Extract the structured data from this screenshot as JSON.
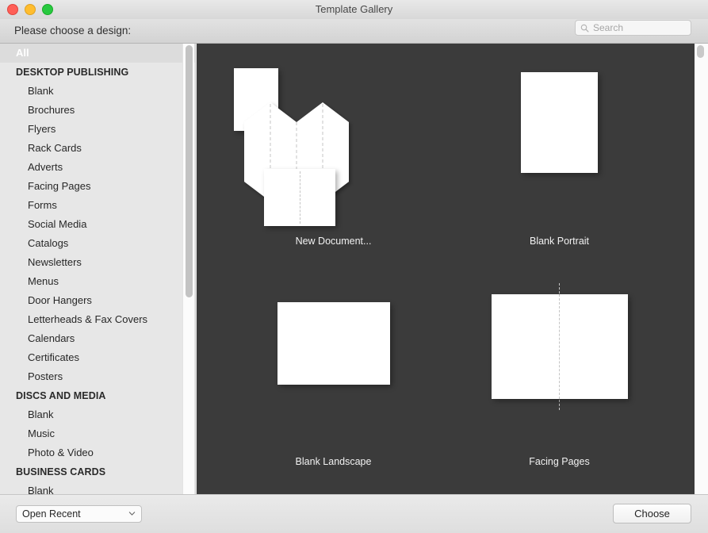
{
  "window": {
    "title": "Template Gallery",
    "traffic_lights": [
      "close-button",
      "minimize-button",
      "zoom-button"
    ]
  },
  "toolbar": {
    "prompt": "Please choose a design:",
    "search": {
      "placeholder": "Search",
      "value": "",
      "icon": "search-icon"
    }
  },
  "sidebar": {
    "selected": "All",
    "items": [
      {
        "label": "All",
        "type": "selected"
      },
      {
        "label": "DESKTOP PUBLISHING",
        "type": "group"
      },
      {
        "label": "Blank",
        "type": "item"
      },
      {
        "label": "Brochures",
        "type": "item"
      },
      {
        "label": "Flyers",
        "type": "item"
      },
      {
        "label": "Rack Cards",
        "type": "item"
      },
      {
        "label": "Adverts",
        "type": "item"
      },
      {
        "label": "Facing Pages",
        "type": "item"
      },
      {
        "label": "Forms",
        "type": "item"
      },
      {
        "label": "Social Media",
        "type": "item"
      },
      {
        "label": "Catalogs",
        "type": "item"
      },
      {
        "label": "Newsletters",
        "type": "item"
      },
      {
        "label": "Menus",
        "type": "item"
      },
      {
        "label": "Door Hangers",
        "type": "item"
      },
      {
        "label": "Letterheads & Fax Covers",
        "type": "item"
      },
      {
        "label": "Calendars",
        "type": "item"
      },
      {
        "label": "Certificates",
        "type": "item"
      },
      {
        "label": "Posters",
        "type": "item"
      },
      {
        "label": "DISCS AND MEDIA",
        "type": "group"
      },
      {
        "label": "Blank",
        "type": "item"
      },
      {
        "label": "Music",
        "type": "item"
      },
      {
        "label": "Photo & Video",
        "type": "item"
      },
      {
        "label": "BUSINESS CARDS",
        "type": "group"
      },
      {
        "label": "Blank",
        "type": "item"
      }
    ]
  },
  "gallery": {
    "background_color": "#3b3b3b",
    "templates": [
      {
        "label": "New Document...",
        "thumb": "stacked-folded-pages"
      },
      {
        "label": "Blank Portrait",
        "thumb": "portrait-page"
      },
      {
        "label": "Blank Landscape",
        "thumb": "landscape-page"
      },
      {
        "label": "Facing Pages",
        "thumb": "facing-pages-spread"
      }
    ]
  },
  "bottom_bar": {
    "open_recent": {
      "selected": "Open Recent",
      "options": [
        "Open Recent"
      ]
    },
    "choose_label": "Choose"
  }
}
